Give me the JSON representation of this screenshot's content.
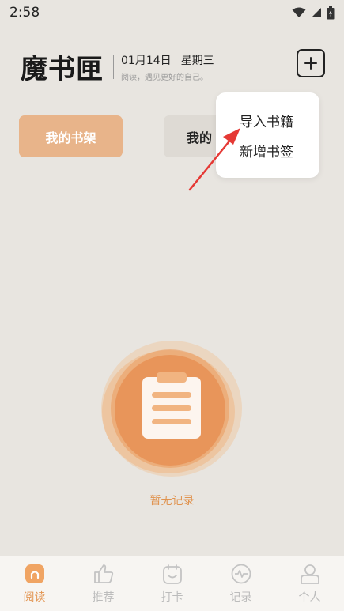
{
  "status_bar": {
    "time": "2:58"
  },
  "header": {
    "logo": "魔书匣",
    "date": "01月14日",
    "weekday": "星期三",
    "slogan": "阅读，遇见更好的自己。"
  },
  "tabs": [
    {
      "label": "我的书架",
      "active": true
    },
    {
      "label": "我的",
      "active": false
    }
  ],
  "popup_menu": {
    "items": [
      {
        "label": "导入书籍"
      },
      {
        "label": "新增书签"
      }
    ]
  },
  "empty_state": {
    "text": "暂无记录"
  },
  "bottom_nav": {
    "items": [
      {
        "label": "阅读",
        "icon": "home-icon",
        "active": true
      },
      {
        "label": "推荐",
        "icon": "thumbs-up-icon",
        "active": false
      },
      {
        "label": "打卡",
        "icon": "checkin-icon",
        "active": false
      },
      {
        "label": "记录",
        "icon": "activity-icon",
        "active": false
      },
      {
        "label": "个人",
        "icon": "person-icon",
        "active": false
      }
    ]
  },
  "colors": {
    "background": "#e8e5e0",
    "accent": "#e39552",
    "tab_active": "#e8b48a",
    "arrow": "#e53935"
  }
}
